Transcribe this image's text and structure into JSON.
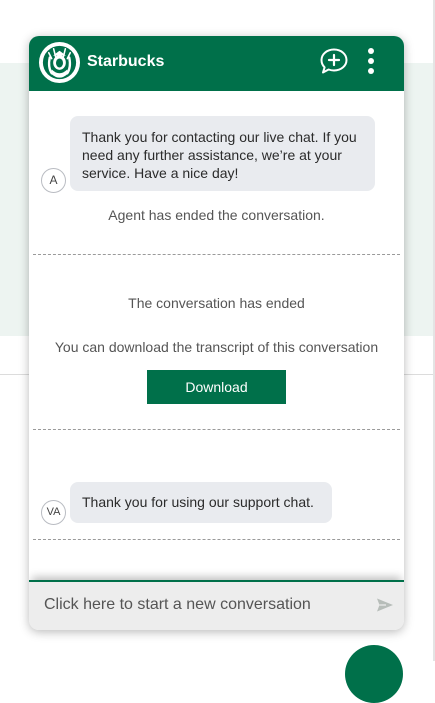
{
  "header": {
    "brand": "Starbucks",
    "icons": [
      "starbucks-siren-logo",
      "new-chat-icon",
      "more-vertical-icon"
    ]
  },
  "conversation": {
    "agent_message": "Thank you for contacting our live chat. If you need any further assistance, we’re at your service. Have a nice day!",
    "agent_avatar": "A",
    "agent_ended": "Agent has ended the conversation.",
    "conversation_ended": "The conversation has ended",
    "transcript_note": "You can download the transcript of this conversation",
    "download_label": "Download",
    "bot_message": "Thank you for using our support chat.",
    "bot_avatar": "VA"
  },
  "composer": {
    "placeholder": "Click here to start a new conversation",
    "send_icon": "send-arrow-icon"
  },
  "colors": {
    "brand_green": "#00704a",
    "bubble_bg": "#e9ebef",
    "page_band": "#edf4f1"
  }
}
